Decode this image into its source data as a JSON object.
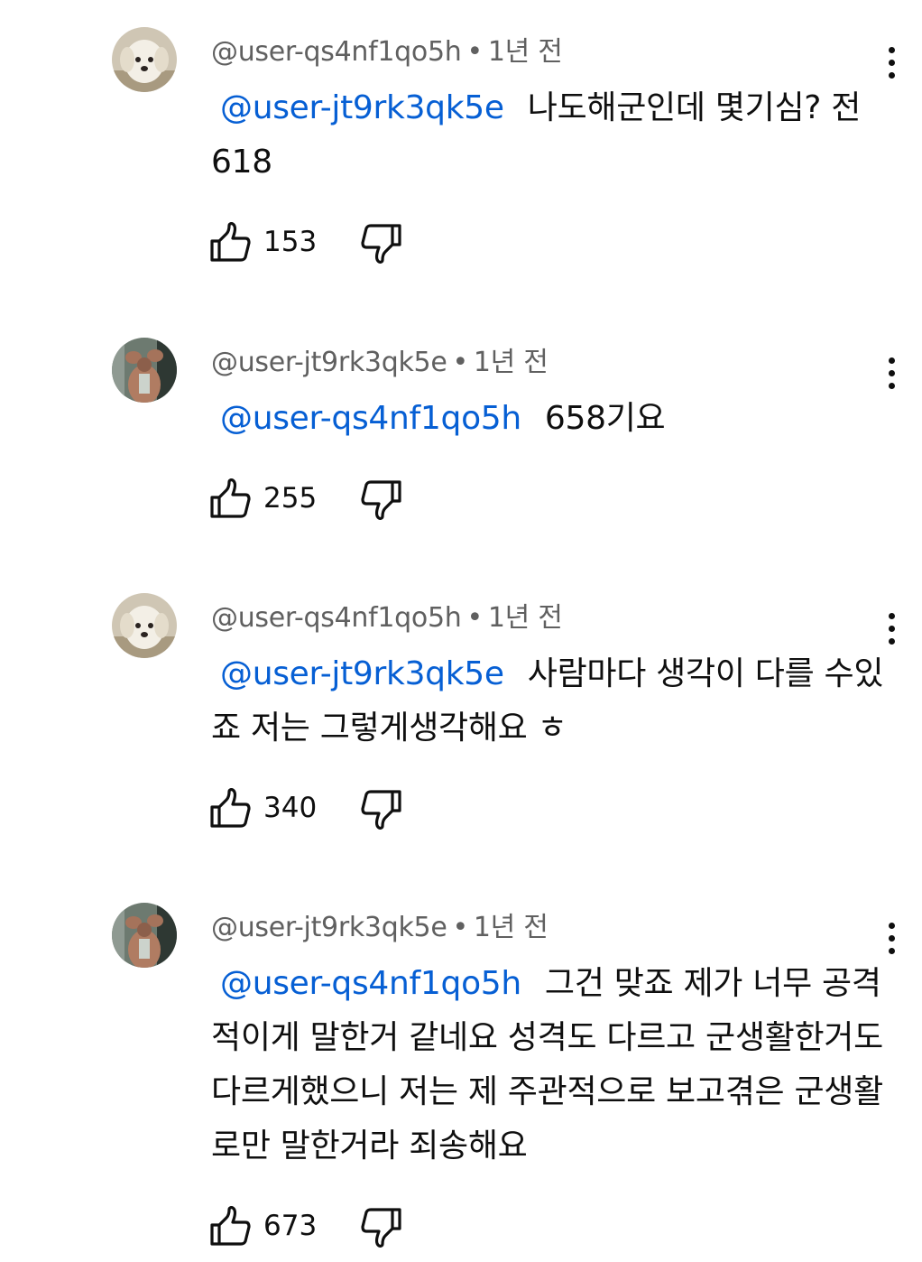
{
  "comments": [
    {
      "author": "@user-qs4nf1qo5h",
      "time": "1년 전",
      "avatar": "puppy-avatar",
      "mention": "@user-jt9rk3qk5e",
      "text": "나도해군인데 몇기심? 전 618",
      "likes": "153"
    },
    {
      "author": "@user-jt9rk3qk5e",
      "time": "1년 전",
      "avatar": "muscle-avatar",
      "mention": "@user-qs4nf1qo5h",
      "text": "658기요",
      "likes": "255"
    },
    {
      "author": "@user-qs4nf1qo5h",
      "time": "1년 전",
      "avatar": "puppy-avatar",
      "mention": "@user-jt9rk3qk5e",
      "text": "사람마다 생각이 다를 수있죠 저는 그렇게생각해요 ㅎ",
      "likes": "340"
    },
    {
      "author": "@user-jt9rk3qk5e",
      "time": "1년 전",
      "avatar": "muscle-avatar",
      "mention": "@user-qs4nf1qo5h",
      "text": "그건 맞죠 제가 너무 공격적이게 말한거 같네요 성격도 다르고 군생활한거도 다르게했으니 저는 제 주관적으로 보고겪은 군생활로만 말한거라 죄송해요",
      "likes": "673"
    }
  ],
  "separator": "•",
  "colors": {
    "mention": "#065fd4",
    "meta": "#606060",
    "text": "#0f0f0f"
  }
}
